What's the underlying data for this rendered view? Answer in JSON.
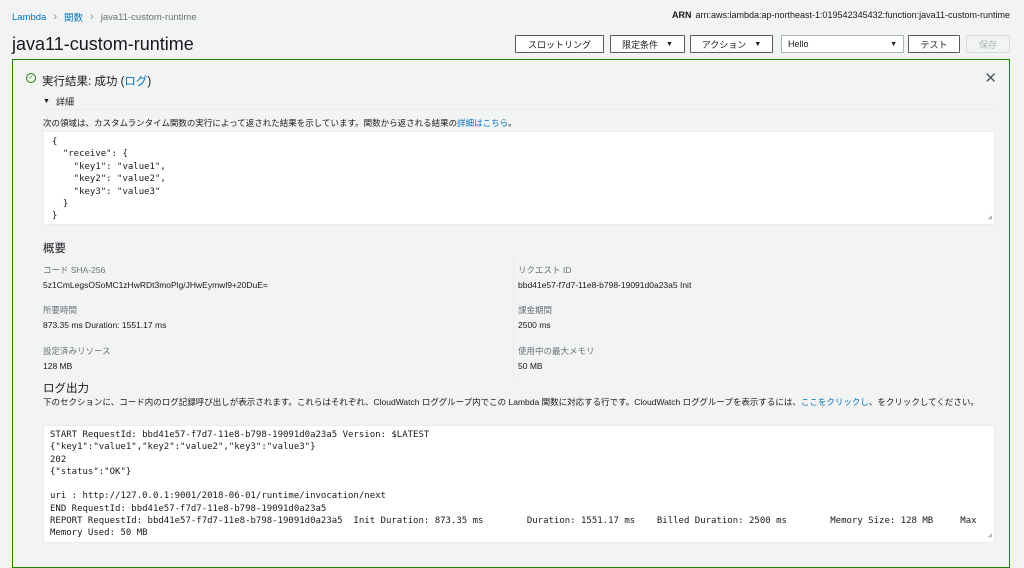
{
  "breadcrumb": {
    "root": "Lambda",
    "functions": "関数",
    "current": "java11-custom-runtime"
  },
  "arn": {
    "label": "ARN",
    "value": "arn:aws:lambda:ap-northeast-1:019542345432:function:java11-custom-runtime"
  },
  "page_title": "java11-custom-runtime",
  "toolbar": {
    "throttle": "スロットリング",
    "qualifiers": "限定条件",
    "actions": "アクション",
    "test_event": "Hello",
    "test": "テスト",
    "save": "保存"
  },
  "result": {
    "title_prefix": "実行結果: 成功 (",
    "title_link": "ログ",
    "title_suffix": ")",
    "details_toggle": "詳細",
    "description": "次の領域は、カスタムランタイム関数の実行によって返された結果を示しています。関数から返される結果の",
    "description_link": "詳細はこちら",
    "description_end": "。",
    "output": "{\n  \"receive\": {\n    \"key1\": \"value1\",\n    \"key2\": \"value2\",\n    \"key3\": \"value3\"\n  }\n}"
  },
  "summary": {
    "heading": "概要",
    "code_sha_label": "コード SHA-256",
    "code_sha_value": "5z1CmLegsOSoMC1zHwRDt3moPlg/JHwEymwl9+20DuE=",
    "request_id_label": "リクエスト ID",
    "request_id_value": "bbd41e57-f7d7-11e8-b798-19091d0a23a5 Init",
    "duration_label": "所要時間",
    "duration_value": "873.35 ms Duration: 1551.17 ms",
    "billed_label": "課金期間",
    "billed_value": "2500 ms",
    "resources_label": "設定済みリソース",
    "resources_value": "128 MB",
    "max_memory_label": "使用中の最大メモリ",
    "max_memory_value": "50 MB"
  },
  "log": {
    "heading": "ログ出力",
    "description": "下のセクションに、コード内のログ記録呼び出しが表示されます。これらはそれぞれ、CloudWatch ロググループ内でこの Lambda 関数に対応する行です。CloudWatch ロググループを表示するには、",
    "description_link": "ここをクリックし",
    "description_end": "、をクリックしてください。",
    "output": "START RequestId: bbd41e57-f7d7-11e8-b798-19091d0a23a5 Version: $LATEST\n{\"key1\":\"value1\",\"key2\":\"value2\",\"key3\":\"value3\"}\n202\n{\"status\":\"OK\"}\n\nuri : http://127.0.0.1:9001/2018-06-01/runtime/invocation/next\nEND RequestId: bbd41e57-f7d7-11e8-b798-19091d0a23a5\nREPORT RequestId: bbd41e57-f7d7-11e8-b798-19091d0a23a5  Init Duration: 873.35 ms        Duration: 1551.17 ms    Billed Duration: 2500 ms        Memory Size: 128 MB     Max\nMemory Used: 50 MB"
  },
  "colors": {
    "link": "#0073bb",
    "success": "#1d8102",
    "background": "#f2f3f3"
  },
  "icons": {
    "status": "check-circle-icon",
    "close": "close-icon",
    "caret": "caret-down-icon",
    "toggle": "triangle-down-icon",
    "resize": "resize-handle-icon"
  }
}
